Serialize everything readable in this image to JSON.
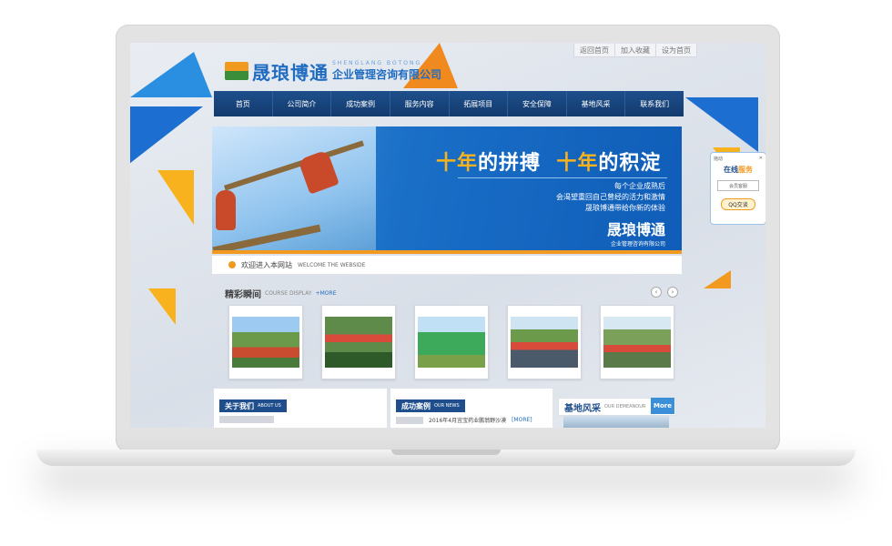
{
  "site": {
    "top_links": [
      "返回首页",
      "加入收藏",
      "设为首页"
    ],
    "logo_main": "晟琅博通",
    "logo_en": "SHENGLANG BOTONG",
    "logo_cn": "企业管理咨询有限公司"
  },
  "nav": {
    "items": [
      "首页",
      "公司简介",
      "成功案例",
      "服务内容",
      "拓展项目",
      "安全保障",
      "基地风采",
      "联系我们"
    ]
  },
  "banner": {
    "title_a1": "十年",
    "title_a2": "的拼搏",
    "title_b1": "十年",
    "title_b2": "的积淀",
    "line1": "每个企业成熟后",
    "line2": "会渴望重回自己曾经的活力和激情",
    "line3": "晟琅博通带给你新的体验",
    "logo_main": "晟琅博通",
    "logo_sub": "企业管理咨询有限公司"
  },
  "welcome": {
    "cn": "欢迎进入本网站",
    "en": "WELCOME THE WEBSIDE"
  },
  "course": {
    "title": "精彩瞬间",
    "en": "COURSE DISPLAY",
    "more": "+MORE"
  },
  "about": {
    "title": "关于我们",
    "en": "ABOUT US"
  },
  "news": {
    "title": "成功案例",
    "en": "OUR NEWS",
    "item": "2016年4月宜宝药业鹏翁野沙漠",
    "more": "[MORE]"
  },
  "base_section": {
    "title": "基地风采",
    "en": "OUR DEMEANOUR",
    "more": "More"
  },
  "service": {
    "left": "拖动",
    "title_a": "在线",
    "title_b": "服务",
    "button": "会员客服",
    "qq": "QQ交谈"
  },
  "colors": {
    "nav": "#1e4f8c",
    "brand_blue": "#1f6cc1",
    "accent_orange": "#f29a1f"
  }
}
